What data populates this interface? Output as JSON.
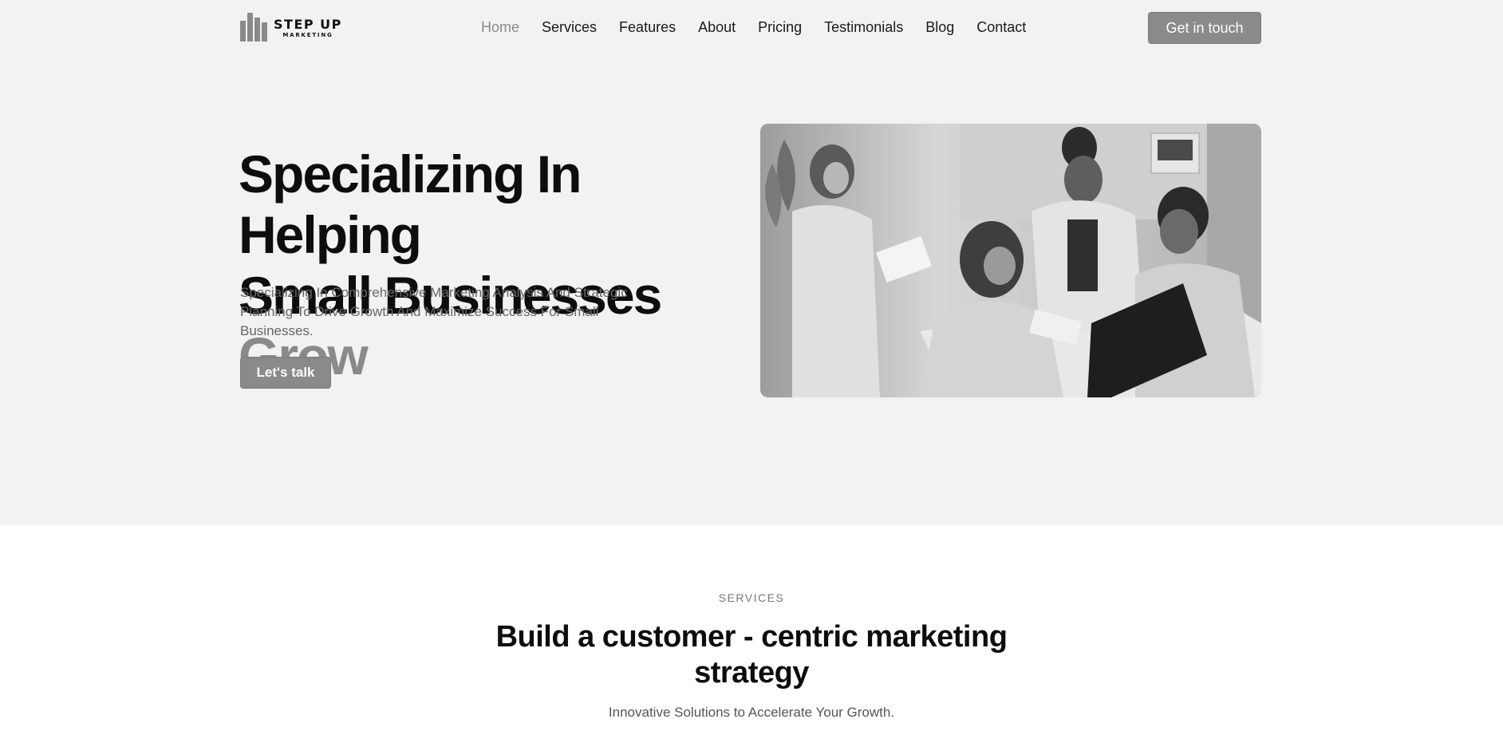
{
  "header": {
    "logo_title": "STEP UP",
    "logo_subtitle": "MARKETING",
    "nav": [
      {
        "label": "Home",
        "active": true
      },
      {
        "label": "Services",
        "active": false
      },
      {
        "label": "Features",
        "active": false
      },
      {
        "label": "About",
        "active": false
      },
      {
        "label": "Pricing",
        "active": false
      },
      {
        "label": "Testimonials",
        "active": false
      },
      {
        "label": "Blog",
        "active": false
      },
      {
        "label": "Contact",
        "active": false
      }
    ],
    "cta_label": "Get in touch"
  },
  "hero": {
    "title_line1": "Specializing In Helping",
    "title_line2": "Small Businesses",
    "title_accent": "Grow",
    "subtitle": "Specializing In Comprehensive Marketing Analysis And Strategic Planning To Drive Growth And Maximize Success For Small Businesses.",
    "cta_label": "Let's talk",
    "image_alt": "team-meeting-photo"
  },
  "services": {
    "eyebrow": "SERVICES",
    "title": "Build a customer - centric marketing strategy",
    "subtitle": "Innovative Solutions to Accelerate Your Growth."
  },
  "colors": {
    "accent": "#8a8a8a",
    "hero_bg": "#f2f2f2",
    "page_bg": "#ffffff",
    "text": "#111111"
  }
}
